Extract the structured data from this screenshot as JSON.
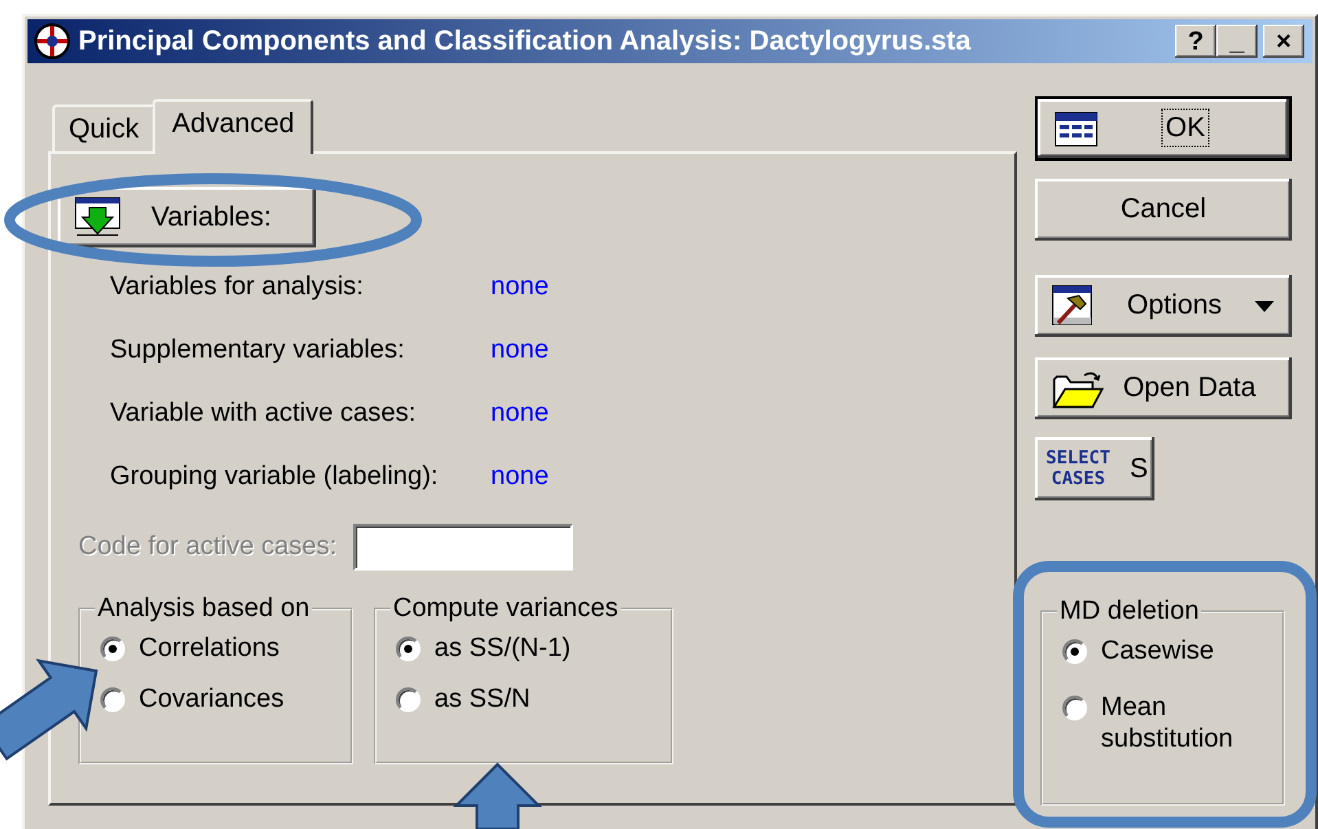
{
  "window": {
    "title": "Principal Components and Classification Analysis: Dactylogyrus.sta",
    "controls": [
      "?",
      "_",
      "×"
    ]
  },
  "tabs": [
    {
      "label": "Quick",
      "selected": false
    },
    {
      "label": "Advanced",
      "selected": true
    }
  ],
  "variables_button": {
    "label": "Variables:"
  },
  "variable_fields": [
    {
      "label": "Variables for analysis:",
      "value": "none"
    },
    {
      "label": "Supplementary variables:",
      "value": "none"
    },
    {
      "label": "Variable with active cases:",
      "value": "none"
    },
    {
      "label": "Grouping variable (labeling):",
      "value": "none"
    }
  ],
  "code_field": {
    "label": "Code for active cases:",
    "disabled": true
  },
  "groups": [
    {
      "title": "Analysis based on",
      "options": [
        {
          "label": "Correlations",
          "selected": true
        },
        {
          "label": "Covariances",
          "selected": false
        }
      ]
    },
    {
      "title": "Compute variances",
      "options": [
        {
          "label": "as SS/(N-1)",
          "selected": true
        },
        {
          "label": "as SS/N",
          "selected": false
        }
      ]
    }
  ],
  "buttons": [
    {
      "kind": "ok",
      "label": "OK",
      "default": true
    },
    {
      "kind": "cancel",
      "label": "Cancel",
      "default": false
    },
    {
      "kind": "options",
      "label": "Options",
      "default": false
    },
    {
      "kind": "open",
      "label": "Open Data",
      "default": false
    },
    {
      "kind": "select",
      "label": "S",
      "icon_lines": [
        "SELECT",
        "CASES"
      ],
      "default": false
    }
  ],
  "md_deletion": {
    "title": "MD deletion",
    "options": [
      {
        "label": "Casewise",
        "selected": true
      },
      {
        "label": "Mean substitution",
        "selected": false
      }
    ]
  },
  "annotations": [
    {
      "kind": "ellipse"
    },
    {
      "kind": "arrow"
    },
    {
      "kind": "arrow"
    },
    {
      "kind": "frame"
    }
  ]
}
